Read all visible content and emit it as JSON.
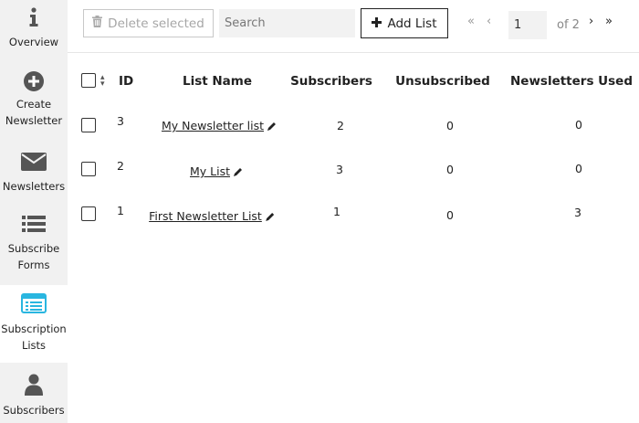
{
  "sidebar": {
    "items": [
      {
        "label": "Overview",
        "icon": "info-icon",
        "active": false
      },
      {
        "label": "Create Newsletter",
        "icon": "plus-circle-icon",
        "active": false
      },
      {
        "label": "Newsletters",
        "icon": "envelope-icon",
        "active": false
      },
      {
        "label": "Subscribe Forms",
        "icon": "list-icon",
        "active": false
      },
      {
        "label": "Subscription Lists",
        "icon": "list-card-icon",
        "active": true
      },
      {
        "label": "Subscribers",
        "icon": "user-icon",
        "active": false
      }
    ]
  },
  "toolbar": {
    "delete_label": "Delete selected",
    "search_placeholder": "Search",
    "add_list_label": "Add List"
  },
  "pagination": {
    "current_page": "1",
    "of_label": "of 2"
  },
  "table": {
    "headers": {
      "id": "ID",
      "list_name": "List Name",
      "subscribers": "Subscribers",
      "unsubscribed": "Unsubscribed",
      "newsletters_used": "Newsletters Used"
    },
    "rows": [
      {
        "id": "3",
        "name": "My Newsletter list",
        "subscribers": "2",
        "unsubscribed": "0",
        "newsletters_used": "0"
      },
      {
        "id": "2",
        "name": "My List",
        "subscribers": "3",
        "unsubscribed": "0",
        "newsletters_used": "0"
      },
      {
        "id": "1",
        "name": "First Newsletter List",
        "subscribers": "1",
        "unsubscribed": "0",
        "newsletters_used": "3"
      }
    ]
  },
  "colors": {
    "sidebar_bg": "#f1f1f1",
    "icon_gray": "#555555",
    "active_icon": "#29b6e0"
  }
}
